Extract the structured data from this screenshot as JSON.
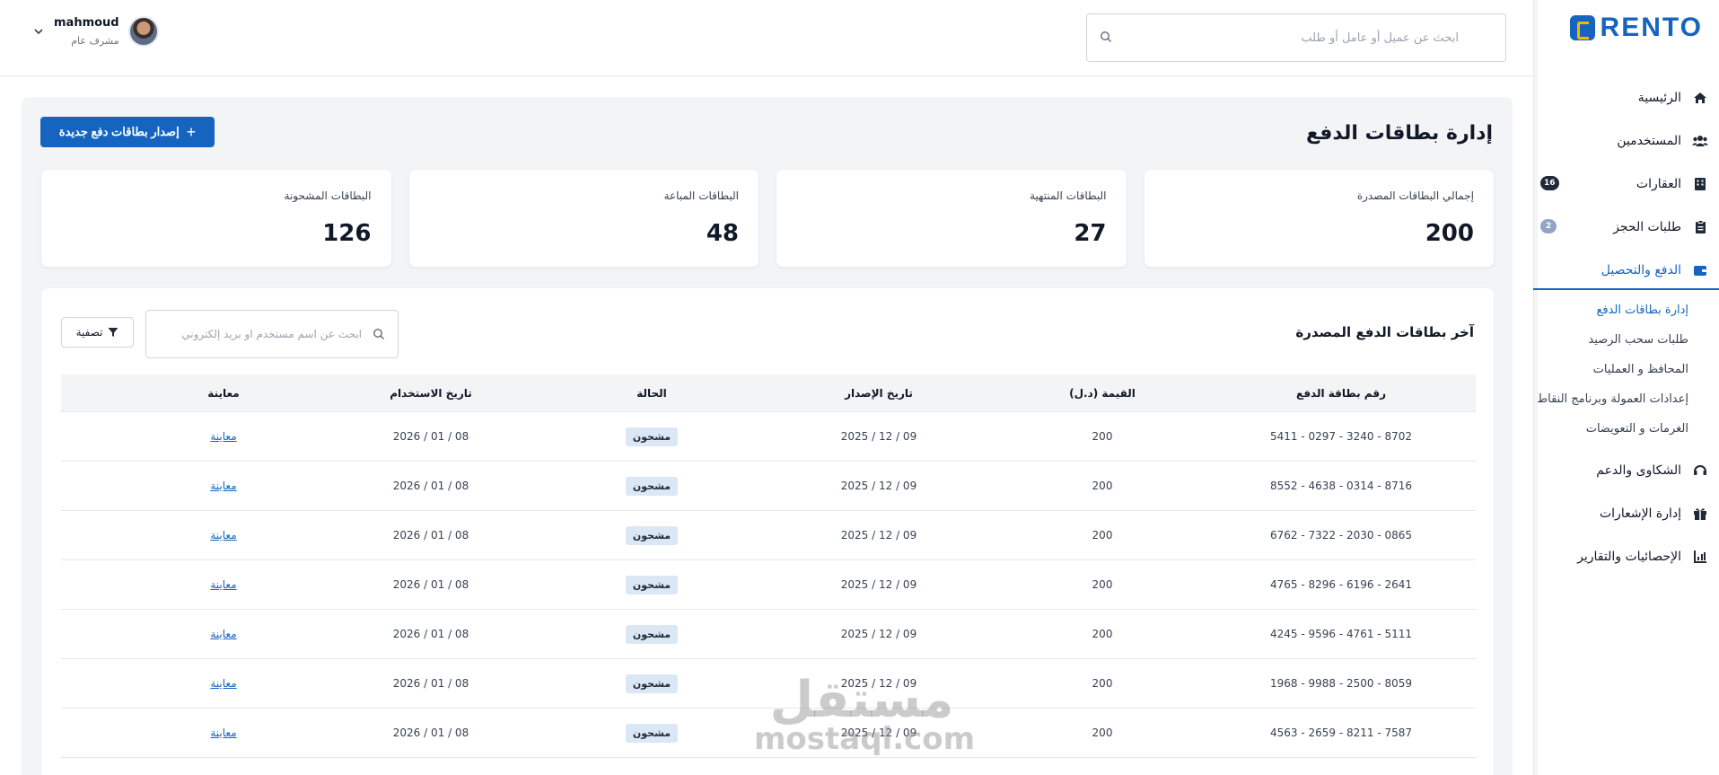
{
  "brand": {
    "name": "RENTO"
  },
  "topbar": {
    "search_placeholder": "ابحث عن عميل أو عامل أو طلب",
    "user": {
      "name": "mahmoud",
      "role": "مشرف عام"
    }
  },
  "sidebar": {
    "items": [
      {
        "label": "الرئيسية",
        "icon": "home-icon"
      },
      {
        "label": "المستخدمين",
        "icon": "users-icon"
      },
      {
        "label": "العقارات",
        "icon": "building-icon",
        "badge": "16"
      },
      {
        "label": "طلبات الحجز",
        "icon": "clipboard-icon",
        "badge": "2"
      },
      {
        "label": "الدفع والتحصيل",
        "icon": "wallet-icon"
      },
      {
        "label": "الشكاوى والدعم",
        "icon": "headset-icon"
      },
      {
        "label": "إدارة الإشعارات",
        "icon": "gift-icon"
      },
      {
        "label": "الإحصائيات والتقارير",
        "icon": "chart-icon"
      }
    ],
    "payment_sub": [
      "إدارة بطاقات الدفع",
      "طلبات سحب الرصيد",
      "المحافظ و العمليات",
      "إعدادات العمولة وبرنامج النقاط",
      "الغرمات و التعويضات"
    ]
  },
  "main": {
    "title": "إدارة بطاقات الدفع",
    "issue_button": "إصدار بطاقات دفع جديدة",
    "stats": [
      {
        "label": "إجمالي البطاقات المصدرة",
        "value": "200"
      },
      {
        "label": "البطاقات المنتهية",
        "value": "27"
      },
      {
        "label": "البطاقات المباعة",
        "value": "48"
      },
      {
        "label": "البطاقات المشحونة",
        "value": "126"
      }
    ],
    "table": {
      "title": "آخر بطاقات الدفع المصدرة",
      "search_placeholder": "ابحث عن اسم مستخدم او بريد إلكتروني",
      "filter_label": "تصفية",
      "headers": [
        "رقم بطاقة الدفع",
        "القيمة (د.ل)",
        "تاريخ الإصدار",
        "الحالة",
        "تاريخ الاستخدام",
        "معاينة"
      ],
      "rows": [
        {
          "card": "5411 - 0297 - 3240 - 8702",
          "value": "200",
          "issued": "2025 / 12 / 09",
          "status": "مشحون",
          "used": "2026 / 01 / 08",
          "view": "معاينة"
        },
        {
          "card": "8552 - 4638 - 0314 - 8716",
          "value": "200",
          "issued": "2025 / 12 / 09",
          "status": "مشحون",
          "used": "2026 / 01 / 08",
          "view": "معاينة"
        },
        {
          "card": "6762 - 7322 - 2030 - 0865",
          "value": "200",
          "issued": "2025 / 12 / 09",
          "status": "مشحون",
          "used": "2026 / 01 / 08",
          "view": "معاينة"
        },
        {
          "card": "4765 - 8296 - 6196 - 2641",
          "value": "200",
          "issued": "2025 / 12 / 09",
          "status": "مشحون",
          "used": "2026 / 01 / 08",
          "view": "معاينة"
        },
        {
          "card": "4245 - 9596 - 4761 - 5111",
          "value": "200",
          "issued": "2025 / 12 / 09",
          "status": "مشحون",
          "used": "2026 / 01 / 08",
          "view": "معاينة"
        },
        {
          "card": "1968 - 9988 - 2500 - 8059",
          "value": "200",
          "issued": "2025 / 12 / 09",
          "status": "مشحون",
          "used": "2026 / 01 / 08",
          "view": "معاينة"
        },
        {
          "card": "4563 - 2659 - 8211 - 7587",
          "value": "200",
          "issued": "2025 / 12 / 09",
          "status": "مشحون",
          "used": "2026 / 01 / 08",
          "view": "معاينة"
        }
      ]
    }
  },
  "watermark": {
    "arabic": "مستقل",
    "latin": "mostaql.com"
  },
  "colors": {
    "primary": "#1565c0",
    "page_bg": "#f3f4f6",
    "pill_bg": "#dbe7f5"
  }
}
